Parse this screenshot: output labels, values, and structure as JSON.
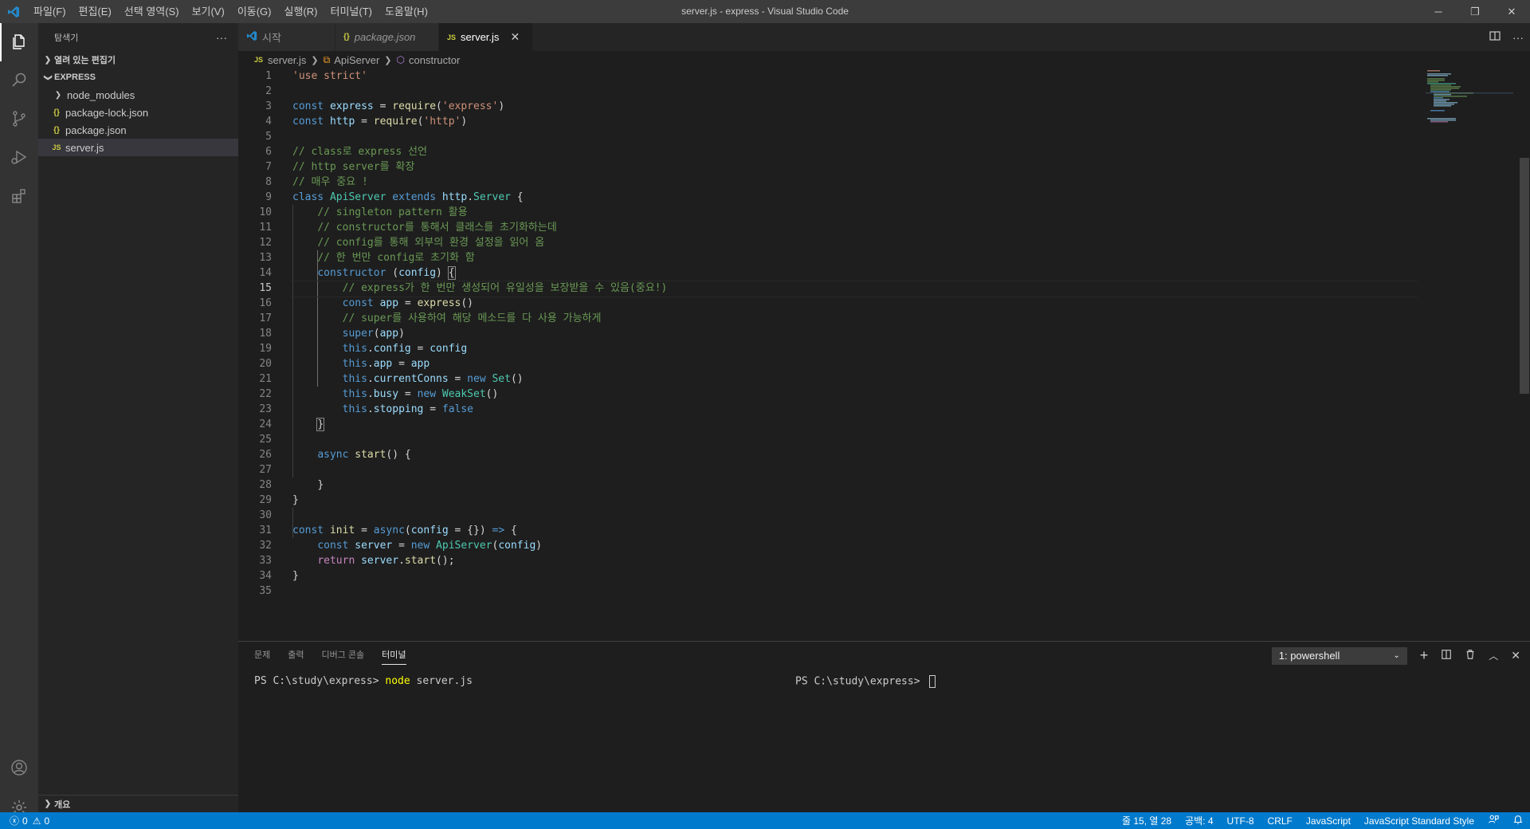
{
  "window": {
    "title": "server.js - express - Visual Studio Code",
    "menu": [
      "파일(F)",
      "편집(E)",
      "선택 영역(S)",
      "보기(V)",
      "이동(G)",
      "실행(R)",
      "터미널(T)",
      "도움말(H)"
    ],
    "controls": {
      "minimize": "─",
      "restore": "❐",
      "close": "✕"
    }
  },
  "activity_icons": [
    "files-icon",
    "search-icon",
    "source-control-icon",
    "run-debug-icon",
    "extensions-icon",
    "account-icon",
    "settings-gear-icon"
  ],
  "sidebar": {
    "title": "탐색기",
    "more": "···",
    "open_editors": "열려 있는 편집기",
    "folder": "EXPRESS",
    "items": [
      {
        "label": "node_modules",
        "icon": "folder-chevron-icon",
        "glyph": "❯"
      },
      {
        "label": "package-lock.json",
        "icon": "json-icon",
        "glyph": "{}"
      },
      {
        "label": "package.json",
        "icon": "json-icon",
        "glyph": "{}"
      },
      {
        "label": "server.js",
        "icon": "js-icon",
        "glyph": "JS",
        "selected": true
      }
    ],
    "outline": "개요"
  },
  "tabs": [
    {
      "label": "시작",
      "icon": "vscode-icon",
      "glyph": "◣"
    },
    {
      "label": "package.json",
      "icon": "json-icon",
      "glyph": "{}",
      "italic": true
    },
    {
      "label": "server.js",
      "icon": "js-icon",
      "glyph": "JS",
      "active": true,
      "close": "✕"
    }
  ],
  "breadcrumb": {
    "file": "server.js",
    "file_glyph": "JS",
    "class": "ApiServer",
    "member": "constructor"
  },
  "code_lines": [
    "1",
    "2",
    "3",
    "4",
    "5",
    "6",
    "7",
    "8",
    "9",
    "10",
    "11",
    "12",
    "13",
    "14",
    "15",
    "16",
    "17",
    "18",
    "19",
    "20",
    "21",
    "22",
    "23",
    "24",
    "25",
    "26",
    "27",
    "28",
    "29",
    "30",
    "31",
    "32",
    "33",
    "34",
    "35"
  ],
  "code": {
    "l1": "'use strict'",
    "l3a": "const",
    "l3b": "express",
    "l3c": " = ",
    "l3d": "require",
    "l3e": "(",
    "l3f": "'express'",
    "l3g": ")",
    "l4a": "const",
    "l4b": "http",
    "l4c": " = ",
    "l4d": "require",
    "l4e": "(",
    "l4f": "'http'",
    "l4g": ")",
    "l6": "// class로 express 선언",
    "l7": "// http server를 확장",
    "l8": "// 매우 중요 !",
    "l9a": "class",
    "l9b": "ApiServer",
    "l9c": "extends",
    "l9d": "http",
    "l9e": ".",
    "l9f": "Server",
    "l9g": " {",
    "l10": "// singleton pattern 활용",
    "l11": "// constructor를 통해서 클래스를 초기화하는데",
    "l12": "// config를 통해 외부의 환경 설정을 읽어 옴",
    "l13": "// 한 번만 config로 초기화 함",
    "l14a": "constructor",
    "l14b": " (",
    "l14c": "config",
    "l14d": ") ",
    "l14e": "{",
    "l15": "// express가 한 번만 생성되어 유일성을 보장받을 수 있음(중요!)",
    "l16a": "const",
    "l16b": "app",
    "l16c": " = ",
    "l16d": "express",
    "l16e": "()",
    "l17": "// super를 사용하여 해당 메소드를 다 사용 가능하게",
    "l18a": "super",
    "l18b": "(",
    "l18c": "app",
    "l18d": ")",
    "l19a": "this",
    "l19b": ".",
    "l19c": "config",
    "l19d": " = ",
    "l19e": "config",
    "l20a": "this",
    "l20b": ".",
    "l20c": "app",
    "l20d": " = ",
    "l20e": "app",
    "l21a": "this",
    "l21b": ".",
    "l21c": "currentConns",
    "l21d": " = ",
    "l21e": "new",
    "l21f": "Set",
    "l21g": "()",
    "l22a": "this",
    "l22b": ".",
    "l22c": "busy",
    "l22d": " = ",
    "l22e": "new",
    "l22f": "WeakSet",
    "l22g": "()",
    "l23a": "this",
    "l23b": ".",
    "l23c": "stopping",
    "l23d": " = ",
    "l23e": "false",
    "l24": "}",
    "l26a": "async",
    "l26b": "start",
    "l26c": "() {",
    "l28": "}",
    "l29": "}",
    "l31a": "const",
    "l31b": "init",
    "l31c": " = ",
    "l31d": "async",
    "l31e": "(",
    "l31f": "config",
    "l31g": " = {}) ",
    "l31h": "=>",
    "l31i": " {",
    "l32a": "const",
    "l32b": "server",
    "l32c": " = ",
    "l32d": "new",
    "l32e": "ApiServer",
    "l32f": "(",
    "l32g": "config",
    "l32h": ")",
    "l33a": "return",
    "l33b": "server",
    "l33c": ".",
    "l33d": "start",
    "l33e": "();",
    "l34": "}"
  },
  "panel": {
    "tabs": [
      "문제",
      "출력",
      "디버그 콘솔",
      "터미널"
    ],
    "active_tab": "터미널",
    "terminal_select": "1: powershell",
    "term1_prompt": "PS C:\\study\\express> ",
    "term1_cmd": "node",
    "term1_arg": " server.js",
    "term2_prompt": "PS C:\\study\\express> "
  },
  "statusbar": {
    "errors": "0",
    "warnings": "0",
    "position": "줄 15, 열 28",
    "indent": "공백: 4",
    "encoding": "UTF-8",
    "eol": "CRLF",
    "language": "JavaScript",
    "formatter": "JavaScript Standard Style"
  },
  "colors": {
    "accent": "#007acc",
    "json": "#cbcb41",
    "js": "#cbcb41",
    "vscode": "#2489ca"
  }
}
